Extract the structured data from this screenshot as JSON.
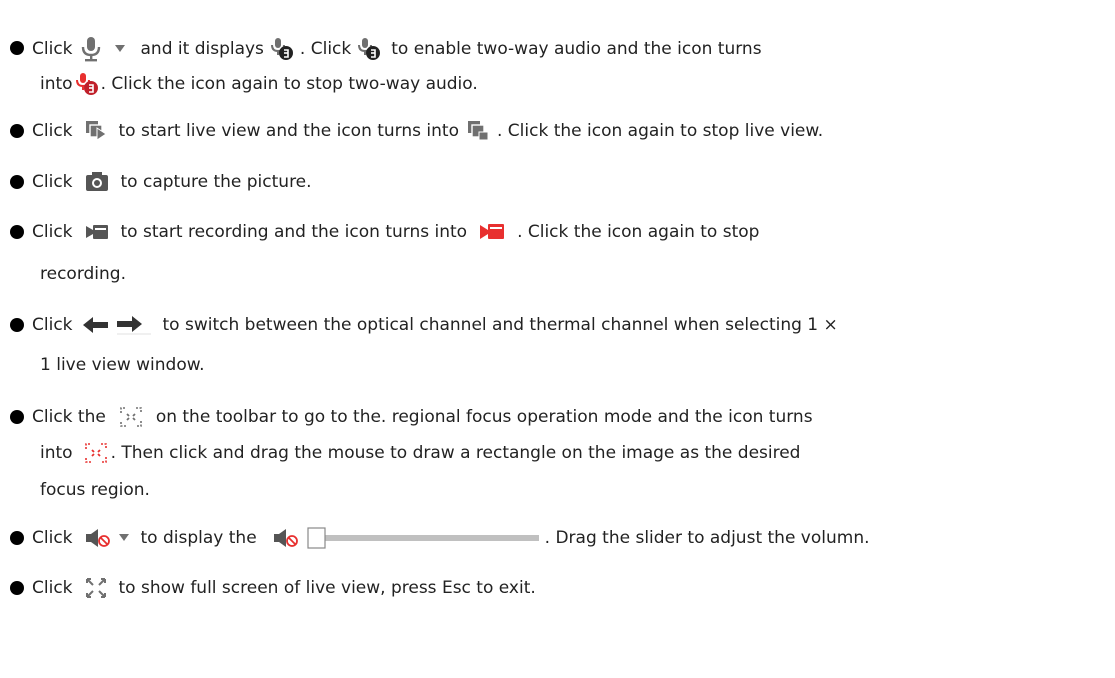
{
  "bullets": [
    {
      "line1_a": "Click",
      "line1_b": "and it displays",
      "line1_c": ". Click",
      "line1_d": "to enable two-way audio and the icon turns",
      "line2_a": "into",
      "line2_b": ". Click the icon again to stop two-way audio."
    },
    {
      "line1_a": "Click",
      "line1_b": "to start live view and the icon turns into",
      "line1_c": ". Click the icon again to stop live view."
    },
    {
      "line1_a": "Click",
      "line1_b": "to capture the picture."
    },
    {
      "line1_a": "Click",
      "line1_b": "to start recording and the icon turns into",
      "line1_c": ". Click the icon again to stop",
      "line2_a": "recording."
    },
    {
      "line1_a": "Click",
      "line1_b": "to switch between the optical channel and thermal channel when selecting 1 ×",
      "line2_a": "1 live view window."
    },
    {
      "line1_a": "Click the",
      "line1_b": "on the toolbar to go to the. regional focus operation mode and the icon turns",
      "line2_a": "into",
      "line2_b": ". Then click and drag the mouse to draw a rectangle on the image as the desired",
      "line3_a": "focus region."
    },
    {
      "line1_a": "Click",
      "line1_b": "to display the",
      "line1_c": ". Drag the slider to adjust the volumn."
    },
    {
      "line1_a": "Click",
      "line1_b": "to show full screen of live view, press Esc to exit."
    }
  ],
  "colors": {
    "icon_gray": "#707070",
    "icon_active_red": "#e8302f",
    "bullet": "#000000"
  },
  "icons": [
    "microphone-icon",
    "dropdown-arrow-icon",
    "two-way-audio-icon",
    "two-way-audio-active-icon",
    "start-live-view-icon",
    "stop-live-view-icon",
    "camera-icon",
    "record-icon",
    "record-active-icon",
    "left-arrow-icon",
    "right-arrow-icon",
    "regional-focus-icon",
    "regional-focus-active-icon",
    "mute-speaker-icon",
    "volume-slider",
    "fullscreen-icon"
  ],
  "volume_slider": {
    "level": 0
  }
}
